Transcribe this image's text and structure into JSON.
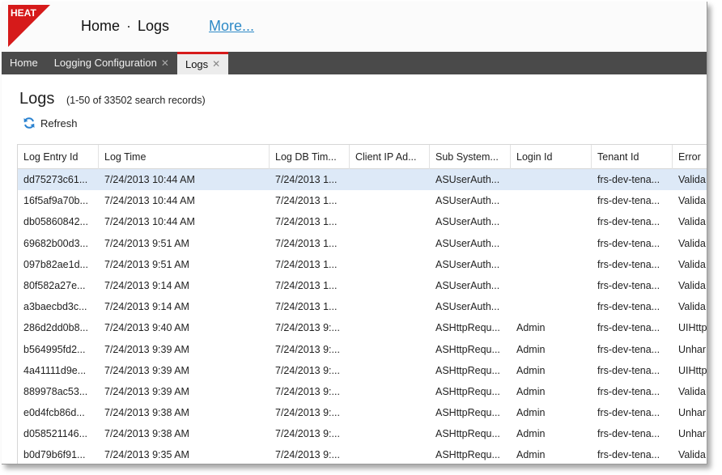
{
  "header": {
    "logo_text": "HEAT",
    "nav": [
      "Home",
      "Logs"
    ],
    "separator": "·",
    "more_link": "More..."
  },
  "tabs": [
    {
      "label": "Home",
      "closable": false,
      "active": false
    },
    {
      "label": "Logging Configuration",
      "closable": true,
      "active": false
    },
    {
      "label": "Logs",
      "closable": true,
      "active": true
    }
  ],
  "close_glyph": "✕",
  "page": {
    "title": "Logs",
    "subtitle": "(1-50 of 33502 search records)",
    "refresh_label": "Refresh"
  },
  "colors": {
    "brand_red": "#d61a1a",
    "tab_bar": "#4a4a4a",
    "selected_row": "#dde9f7",
    "link": "#2e8ac7"
  },
  "grid": {
    "columns": [
      "Log Entry Id",
      "Log Time",
      "Log DB Tim...",
      "Client IP Ad...",
      "Sub System...",
      "Login Id",
      "Tenant Id",
      "Error"
    ],
    "rows": [
      [
        "dd75273c61...",
        "7/24/2013 10:44 AM",
        "7/24/2013 1...",
        "",
        "ASUserAuth...",
        "",
        "frs-dev-tena...",
        "Valida"
      ],
      [
        "16f5af9a70b...",
        "7/24/2013 10:44 AM",
        "7/24/2013 1...",
        "",
        "ASUserAuth...",
        "",
        "frs-dev-tena...",
        "Valida"
      ],
      [
        "db05860842...",
        "7/24/2013 10:44 AM",
        "7/24/2013 1...",
        "",
        "ASUserAuth...",
        "",
        "frs-dev-tena...",
        "Valida"
      ],
      [
        "69682b00d3...",
        "7/24/2013 9:51 AM",
        "7/24/2013 1...",
        "",
        "ASUserAuth...",
        "",
        "frs-dev-tena...",
        "Valida"
      ],
      [
        "097b82ae1d...",
        "7/24/2013 9:51 AM",
        "7/24/2013 1...",
        "",
        "ASUserAuth...",
        "",
        "frs-dev-tena...",
        "Valida"
      ],
      [
        "80f582a27e...",
        "7/24/2013 9:14 AM",
        "7/24/2013 1...",
        "",
        "ASUserAuth...",
        "",
        "frs-dev-tena...",
        "Valida"
      ],
      [
        "a3baecbd3c...",
        "7/24/2013 9:14 AM",
        "7/24/2013 1...",
        "",
        "ASUserAuth...",
        "",
        "frs-dev-tena...",
        "Valida"
      ],
      [
        "286d2dd0b8...",
        "7/24/2013 9:40 AM",
        "7/24/2013 9:...",
        "",
        "ASHttpRequ...",
        "Admin",
        "frs-dev-tena...",
        "UIHttp"
      ],
      [
        "b564995fd2...",
        "7/24/2013 9:39 AM",
        "7/24/2013 9:...",
        "",
        "ASHttpRequ...",
        "Admin",
        "frs-dev-tena...",
        "Unhar"
      ],
      [
        "4a41111d9e...",
        "7/24/2013 9:39 AM",
        "7/24/2013 9:...",
        "",
        "ASHttpRequ...",
        "Admin",
        "frs-dev-tena...",
        "UIHttp"
      ],
      [
        "889978ac53...",
        "7/24/2013 9:39 AM",
        "7/24/2013 9:...",
        "",
        "ASHttpRequ...",
        "Admin",
        "frs-dev-tena...",
        "Valida"
      ],
      [
        "e0d4fcb86d...",
        "7/24/2013 9:38 AM",
        "7/24/2013 9:...",
        "",
        "ASHttpRequ...",
        "Admin",
        "frs-dev-tena...",
        "Unhar"
      ],
      [
        "d058521146...",
        "7/24/2013 9:38 AM",
        "7/24/2013 9:...",
        "",
        "ASHttpRequ...",
        "Admin",
        "frs-dev-tena...",
        "Unhar"
      ],
      [
        "b0d79b6f91...",
        "7/24/2013 9:35 AM",
        "7/24/2013 9:...",
        "",
        "ASHttpRequ...",
        "Admin",
        "frs-dev-tena...",
        "Valida"
      ]
    ],
    "selected_row_index": 0
  }
}
